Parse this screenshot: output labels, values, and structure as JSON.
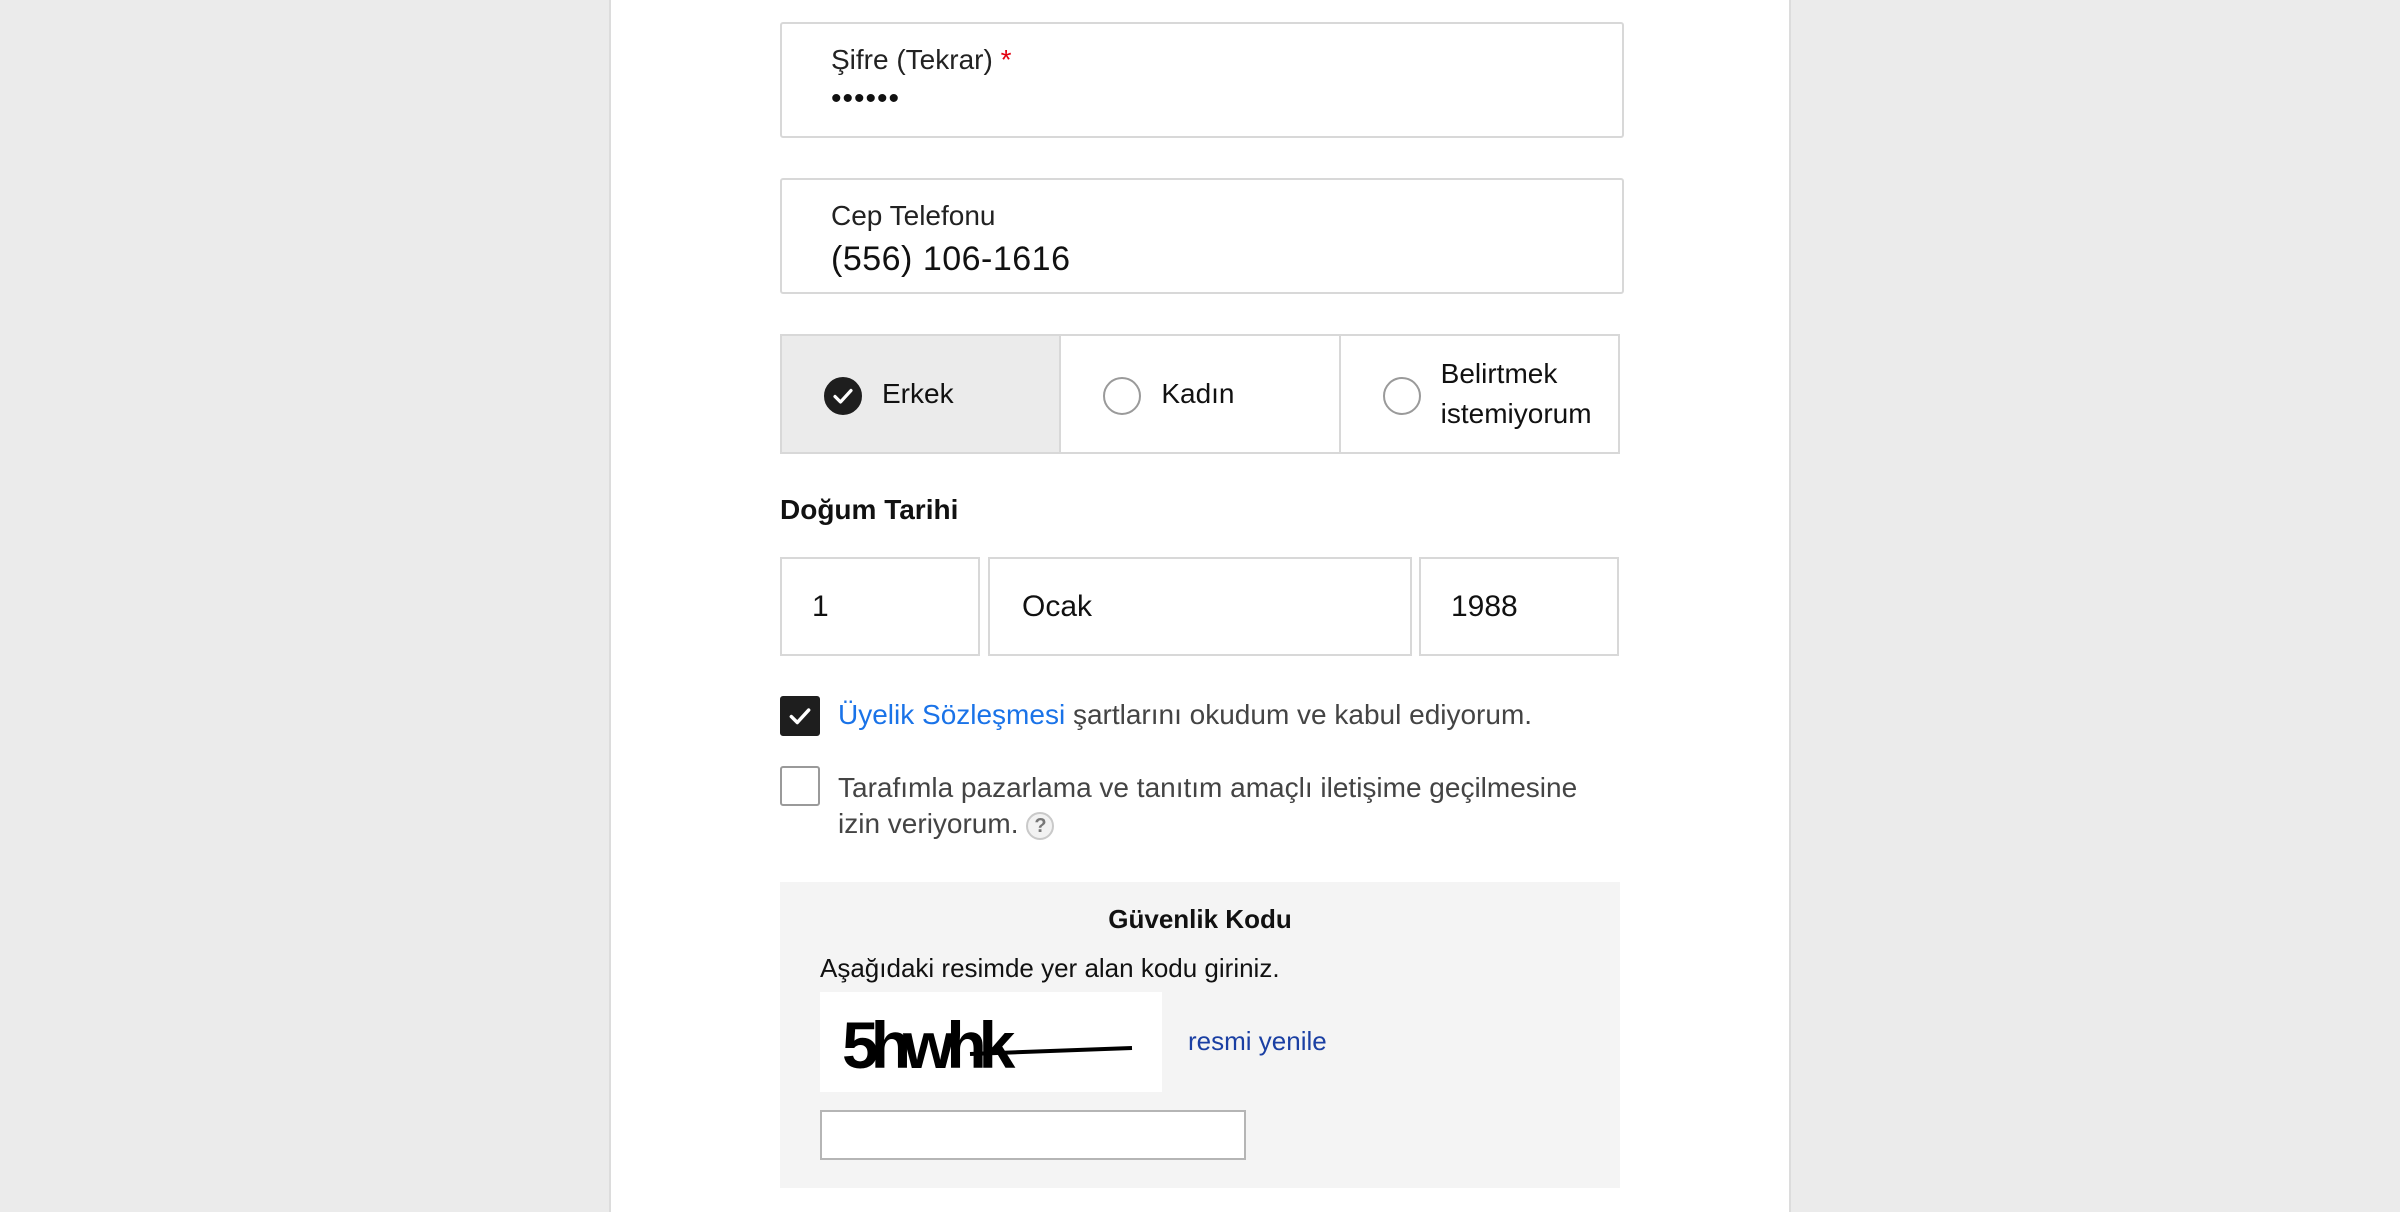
{
  "form": {
    "password_repeat": {
      "label": "Şifre (Tekrar)",
      "required_mark": "*",
      "value": "••••••"
    },
    "phone": {
      "label": "Cep Telefonu",
      "value": "(556) 106-1616"
    },
    "gender": {
      "options": [
        {
          "label": "Erkek",
          "selected": true
        },
        {
          "label": "Kadın",
          "selected": false
        },
        {
          "label_line1": "Belirtmek",
          "label_line2": "istemiyorum",
          "selected": false
        }
      ]
    },
    "birth_date": {
      "title": "Doğum Tarihi",
      "day": "1",
      "month": "Ocak",
      "year": "1988"
    },
    "agreement": {
      "checked": true,
      "link_text": "Üyelik Sözleşmesi",
      "rest_text": " şartlarını okudum ve kabul ediyorum."
    },
    "marketing": {
      "checked": false,
      "line1": "Tarafımla pazarlama ve tanıtım amaçlı iletişime geçilmesine",
      "line2": "izin veriyorum.",
      "help_symbol": "?"
    },
    "security": {
      "title": "Güvenlik Kodu",
      "description": "Aşağıdaki resimde yer alan kodu giriniz.",
      "captcha_text": "5hwhk",
      "refresh_label": "resmi yenile",
      "input_value": ""
    }
  },
  "colors": {
    "background": "#ebebeb",
    "panel": "#ffffff",
    "required": "#e3000f",
    "link": "#1a73e8",
    "refresh_link": "#1a3fa3",
    "checked_fill": "#1e1e1e"
  }
}
